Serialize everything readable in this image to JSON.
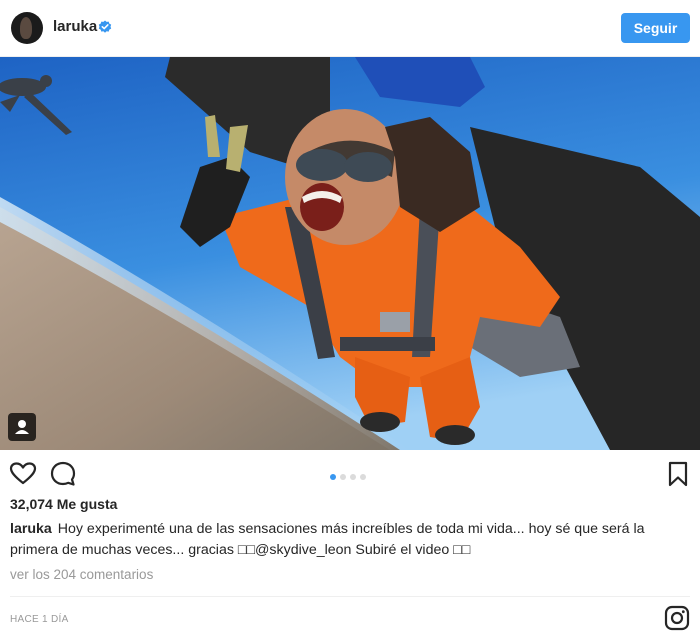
{
  "header": {
    "username": "laruka",
    "verified_icon": "verified-badge-icon",
    "follow_label": "Seguir"
  },
  "photo": {
    "description_icon": "tag-people-icon"
  },
  "actions": {
    "like_icon": "heart-icon",
    "comment_icon": "comment-icon",
    "save_icon": "bookmark-icon",
    "carousel_total": 4,
    "carousel_active": 1
  },
  "post": {
    "likes": "32,074 Me gusta",
    "caption_user": "laruka",
    "caption_text": "Hoy experimenté una de las sensaciones más increíbles de toda mi vida... hoy sé que será la primera de muchas veces... gracias □□@skydive_leon Subiré el video □□",
    "comments_link": "ver los 204 comentarios",
    "timestamp": "HACE 1 DÍA"
  },
  "colors": {
    "accent": "#3897f0",
    "text": "#262626",
    "muted": "#999999"
  }
}
